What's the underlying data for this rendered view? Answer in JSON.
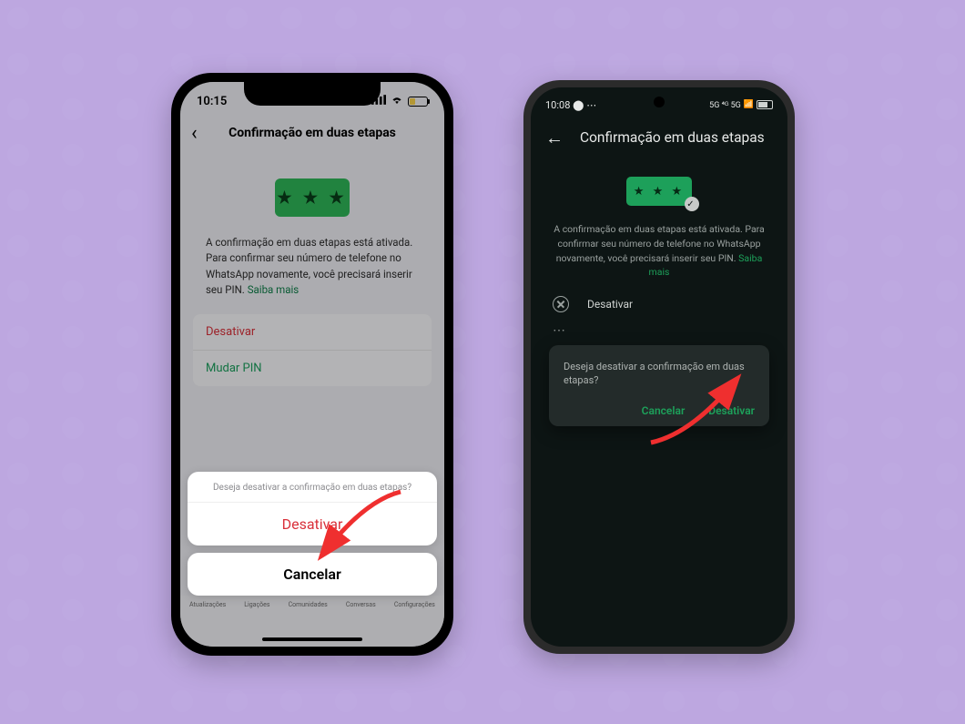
{
  "iphone": {
    "status_time": "10:15",
    "header_title": "Confirmação em duas etapas",
    "pin_glyph": "★ ★ ★",
    "description": "A confirmação em duas etapas está ativada. Para confirmar seu número de telefone no WhatsApp novamente, você precisará inserir seu PIN. ",
    "learn_more": "Saiba mais",
    "option_disable": "Desativar",
    "option_change_pin": "Mudar PIN",
    "sheet_question": "Deseja desativar a confirmação em duas etapas?",
    "sheet_disable": "Desativar",
    "sheet_cancel": "Cancelar",
    "tabs": [
      "Atualizações",
      "Ligações",
      "Comunidades",
      "Conversas",
      "Configurações"
    ]
  },
  "android": {
    "status_time": "10:08",
    "status_right": "5G ⁴ᴳ 5G",
    "header_title": "Confirmação em duas etapas",
    "pin_glyph": "★ ★ ★",
    "description": "A confirmação em duas etapas está ativada. Para confirmar seu número de telefone no WhatsApp novamente, você precisará inserir seu PIN. ",
    "learn_more": "Saiba mais",
    "row_disable": "Desativar",
    "dialog_msg": "Deseja desativar a confirmação em duas etapas?",
    "dialog_cancel": "Cancelar",
    "dialog_confirm": "Desativar"
  }
}
